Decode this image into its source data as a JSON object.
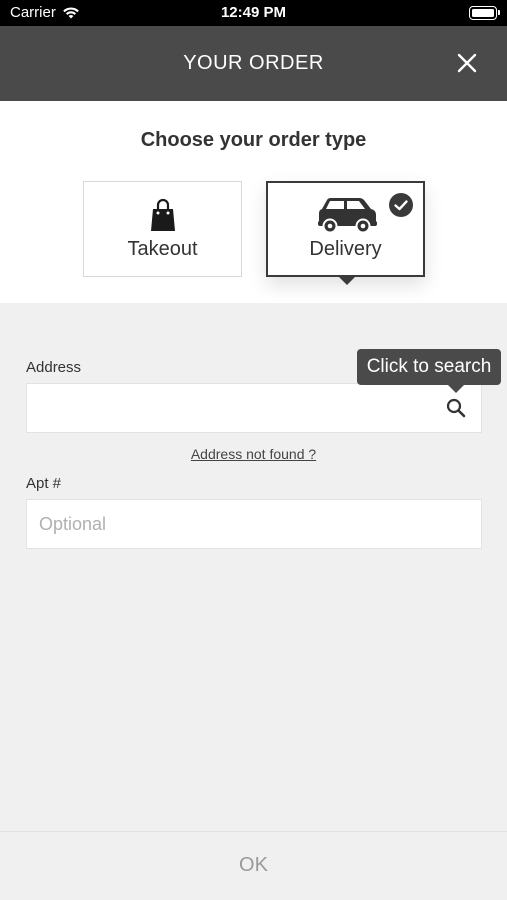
{
  "status_bar": {
    "carrier": "Carrier",
    "time": "12:49 PM"
  },
  "header": {
    "title": "YOUR ORDER",
    "close_icon": "close-icon"
  },
  "order_type": {
    "heading": "Choose your order type",
    "options": [
      {
        "label": "Takeout",
        "icon": "shopping-bag-icon",
        "selected": false
      },
      {
        "label": "Delivery",
        "icon": "car-icon",
        "selected": true
      }
    ]
  },
  "form": {
    "address_label": "Address",
    "address_value": "",
    "tooltip": "Click to search",
    "address_not_found": "Address not found ?",
    "apt_label": "Apt #",
    "apt_placeholder": "Optional"
  },
  "footer": {
    "ok_label": "OK"
  },
  "colors": {
    "header_bg": "#4a4a4a",
    "selected_border": "#3a3a3a",
    "page_bg": "#f0f0f0"
  }
}
